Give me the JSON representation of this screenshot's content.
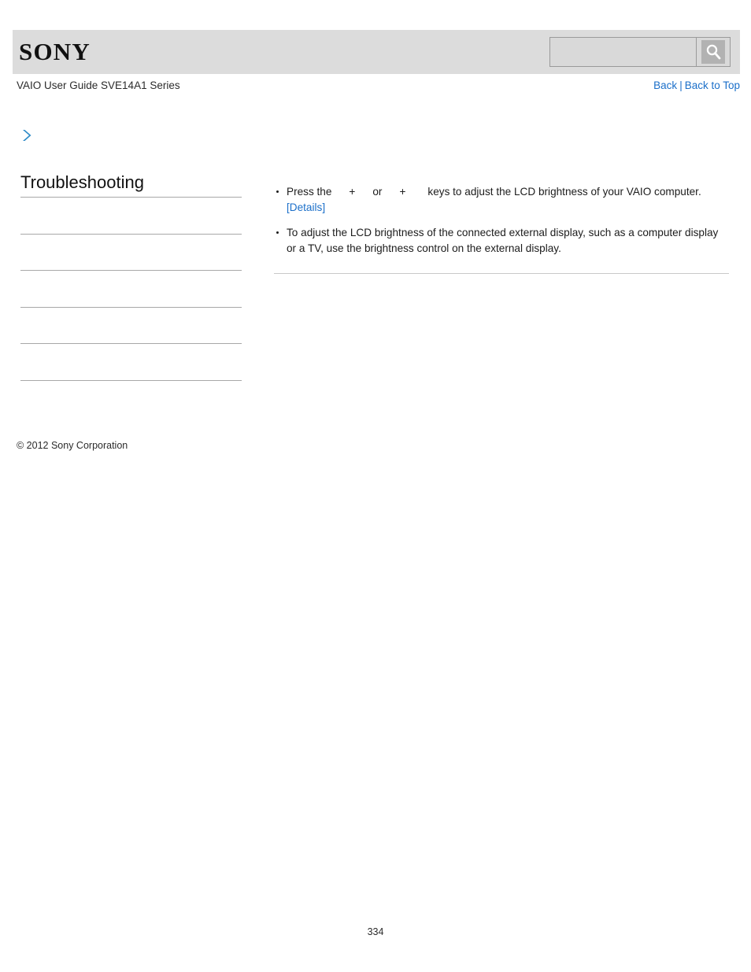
{
  "header": {
    "logo_text": "SONY",
    "logo_icon": "sony-wordmark",
    "search": {
      "value": "",
      "placeholder": "",
      "button_icon": "search-icon"
    }
  },
  "subheader": {
    "guide_title": "VAIO User Guide SVE14A1 Series",
    "nav": {
      "back_label": "Back",
      "separator": "|",
      "back_to_top_label": "Back to Top"
    }
  },
  "breadcrumb": {
    "icon": "chevron-right-icon",
    "text": ""
  },
  "sidebar": {
    "title": "Troubleshooting",
    "items": [
      {
        "label": ""
      },
      {
        "label": ""
      },
      {
        "label": ""
      },
      {
        "label": ""
      },
      {
        "label": ""
      },
      {
        "label": ""
      }
    ],
    "copyright": "© 2012 Sony Corporation"
  },
  "content": {
    "bullets": [
      {
        "text_before_key1": "Press the",
        "plus1": "+",
        "connector": "or",
        "plus2": "+",
        "text_after_key2": "keys to adjust the LCD brightness of your VAIO computer.",
        "link_label": "[Details]"
      },
      {
        "text": "To adjust the LCD brightness of the connected external display, such as a computer display or a TV, use the brightness control on the external display."
      }
    ]
  },
  "footer": {
    "page_number": "334"
  },
  "colors": {
    "header_bg": "#dcdcdc",
    "link": "#1b6fc9",
    "accent_chevron": "#2e8bc8",
    "rule": "#a8a8a8",
    "content_rule": "#c9c9c9",
    "text": "#1c1c1c"
  }
}
